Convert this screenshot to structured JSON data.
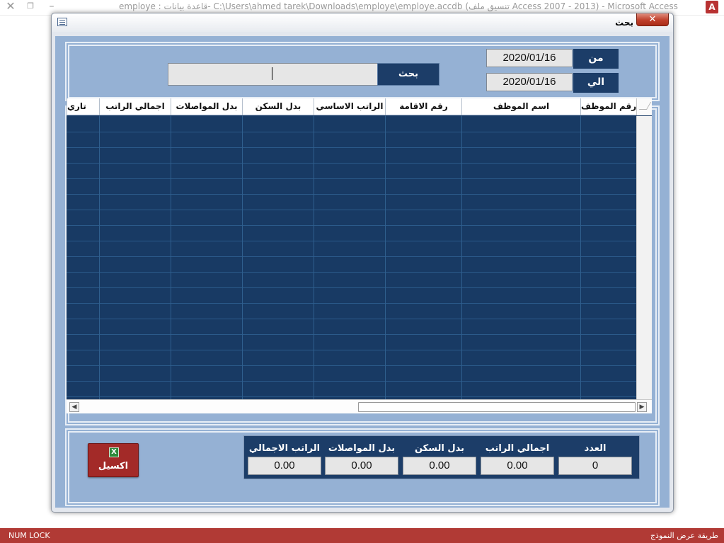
{
  "app": {
    "title": "employe : قاعدة بيانات- C:\\Users\\ahmed tarek\\Downloads\\employe\\employe.accdb (تنسيق ملف Access 2007 - 2013) - Microsoft Access",
    "icon_label": "A"
  },
  "dialog": {
    "title": "بحث",
    "close_label": "✕"
  },
  "search": {
    "from_label": "من",
    "to_label": "الي",
    "date_from": "2020/01/16",
    "date_to": "2020/01/16",
    "search_value": "",
    "search_button_label": "بحث"
  },
  "grid": {
    "columns": [
      "رقم الموظف",
      "اسم الموظف",
      "رقم الاقامة",
      "الراتب  الاساسي",
      "بدل السكن",
      "بدل المواصلات",
      "اجمالي الراتب",
      "تاري"
    ],
    "rows": []
  },
  "totals": {
    "count_label": "العدد",
    "count_value": "0",
    "gross_label": "اجمالي الراتب",
    "gross_value": "0.00",
    "housing_label": "بدل السكن",
    "housing_value": "0.00",
    "transport_label": "بدل المواصلات",
    "transport_value": "0.00",
    "total_label": "الراتب الاجمالي",
    "total_value": "0.00"
  },
  "excel_button": {
    "label": "اكسيل",
    "icon_glyph": "X"
  },
  "status": {
    "left": "NUM LOCK",
    "right": "طريقة عرض النموذج"
  },
  "colors": {
    "dialog_body": "#95b1d4",
    "dark_navy": "#1c3d68",
    "status_bar": "#b13a35",
    "excel_button": "#a32a28"
  },
  "icons": {
    "app_close": "close-icon",
    "app_restore": "restore-icon",
    "app_minimize": "minimize-icon",
    "app": "access-app-icon",
    "dialog": "form-icon",
    "excel": "excel-icon"
  }
}
